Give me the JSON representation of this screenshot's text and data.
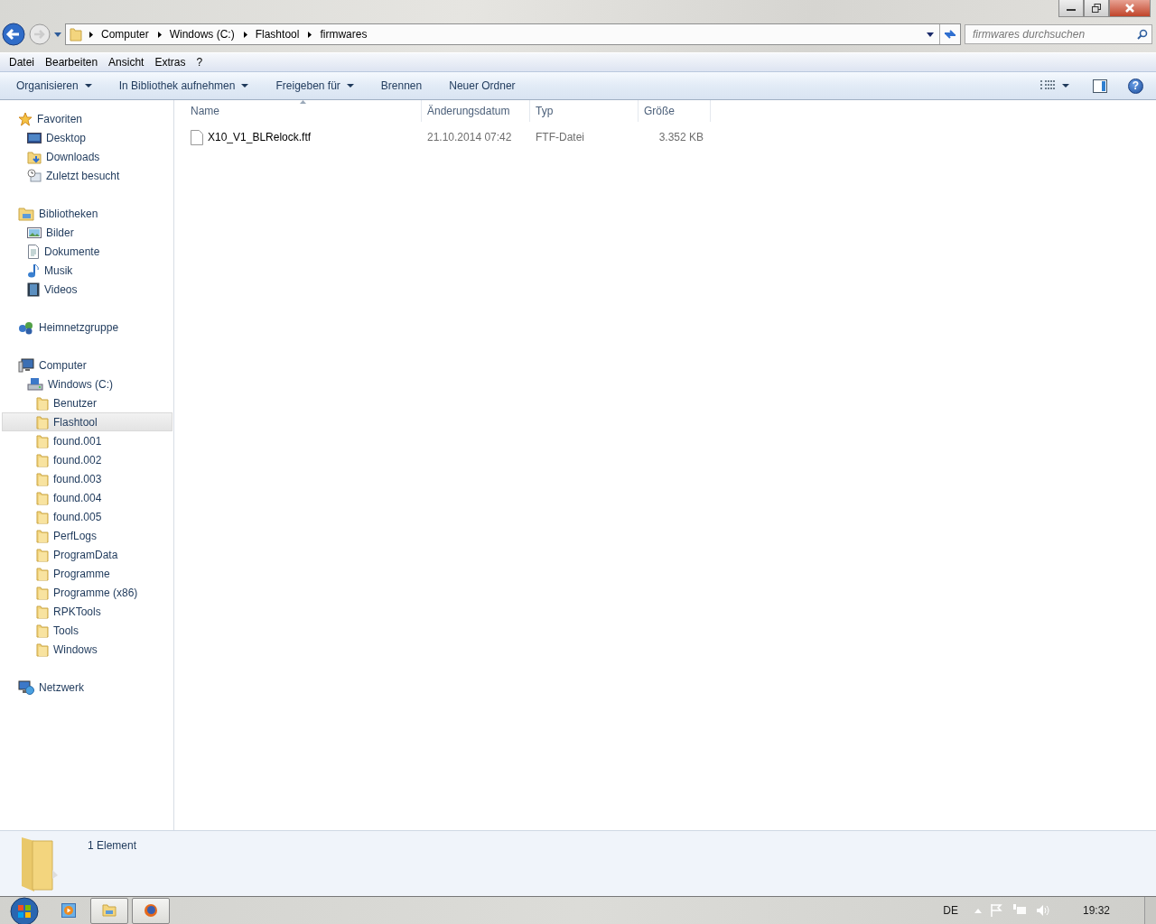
{
  "address_bar": {
    "breadcrumbs": [
      "Computer",
      "Windows (C:)",
      "Flashtool",
      "firmwares"
    ]
  },
  "search": {
    "placeholder": "firmwares durchsuchen"
  },
  "menu": [
    "Datei",
    "Bearbeiten",
    "Ansicht",
    "Extras",
    "?"
  ],
  "toolbar": [
    {
      "label": "Organisieren",
      "dropdown": true
    },
    {
      "label": "In Bibliothek aufnehmen",
      "dropdown": true
    },
    {
      "label": "Freigeben für",
      "dropdown": true
    },
    {
      "label": "Brennen",
      "dropdown": false
    },
    {
      "label": "Neuer Ordner",
      "dropdown": false
    }
  ],
  "help_button": {
    "label": "?"
  },
  "sidebar": {
    "groups": [
      {
        "label": "Favoriten",
        "kind": "star",
        "selected": false,
        "children": [
          {
            "label": "Desktop",
            "kind": "desktop",
            "selected": false
          },
          {
            "label": "Downloads",
            "kind": "downloads",
            "selected": false
          },
          {
            "label": "Zuletzt besucht",
            "kind": "recent",
            "selected": false
          }
        ]
      },
      {
        "label": "Bibliotheken",
        "kind": "library",
        "selected": false,
        "children": [
          {
            "label": "Bilder",
            "kind": "pictures",
            "selected": false
          },
          {
            "label": "Dokumente",
            "kind": "documents",
            "selected": false
          },
          {
            "label": "Musik",
            "kind": "music",
            "selected": false
          },
          {
            "label": "Videos",
            "kind": "videos",
            "selected": false
          }
        ]
      },
      {
        "label": "Heimnetzgruppe",
        "kind": "homegroup",
        "selected": false
      },
      {
        "label": "Computer",
        "kind": "computer",
        "selected": false,
        "children": [
          {
            "label": "Windows (C:)",
            "kind": "drive",
            "selected": false,
            "children": [
              {
                "label": "Benutzer",
                "kind": "folder",
                "selected": false
              },
              {
                "label": "Flashtool",
                "kind": "folder",
                "selected": true
              },
              {
                "label": "found.001",
                "kind": "folder",
                "selected": false
              },
              {
                "label": "found.002",
                "kind": "folder",
                "selected": false
              },
              {
                "label": "found.003",
                "kind": "folder",
                "selected": false
              },
              {
                "label": "found.004",
                "kind": "folder",
                "selected": false
              },
              {
                "label": "found.005",
                "kind": "folder",
                "selected": false
              },
              {
                "label": "PerfLogs",
                "kind": "folder",
                "selected": false
              },
              {
                "label": "ProgramData",
                "kind": "folder",
                "selected": false
              },
              {
                "label": "Programme",
                "kind": "folder",
                "selected": false
              },
              {
                "label": "Programme (x86)",
                "kind": "folder",
                "selected": false
              },
              {
                "label": "RPKTools",
                "kind": "folder",
                "selected": false
              },
              {
                "label": "Tools",
                "kind": "folder",
                "selected": false
              },
              {
                "label": "Windows",
                "kind": "folder",
                "selected": false
              }
            ]
          }
        ]
      },
      {
        "label": "Netzwerk",
        "kind": "network",
        "selected": false
      }
    ]
  },
  "table": {
    "columns": [
      "Name",
      "Änderungsdatum",
      "Typ",
      "Größe"
    ],
    "rows": [
      {
        "cells": [
          "X10_V1_BLRelock.ftf",
          "21.10.2014 07:42",
          "FTF-Datei",
          "3.352 KB"
        ],
        "selected": false
      }
    ]
  },
  "details": {
    "text": "1 Element"
  },
  "taskbar": {
    "language": "DE",
    "clock": "19:32"
  }
}
